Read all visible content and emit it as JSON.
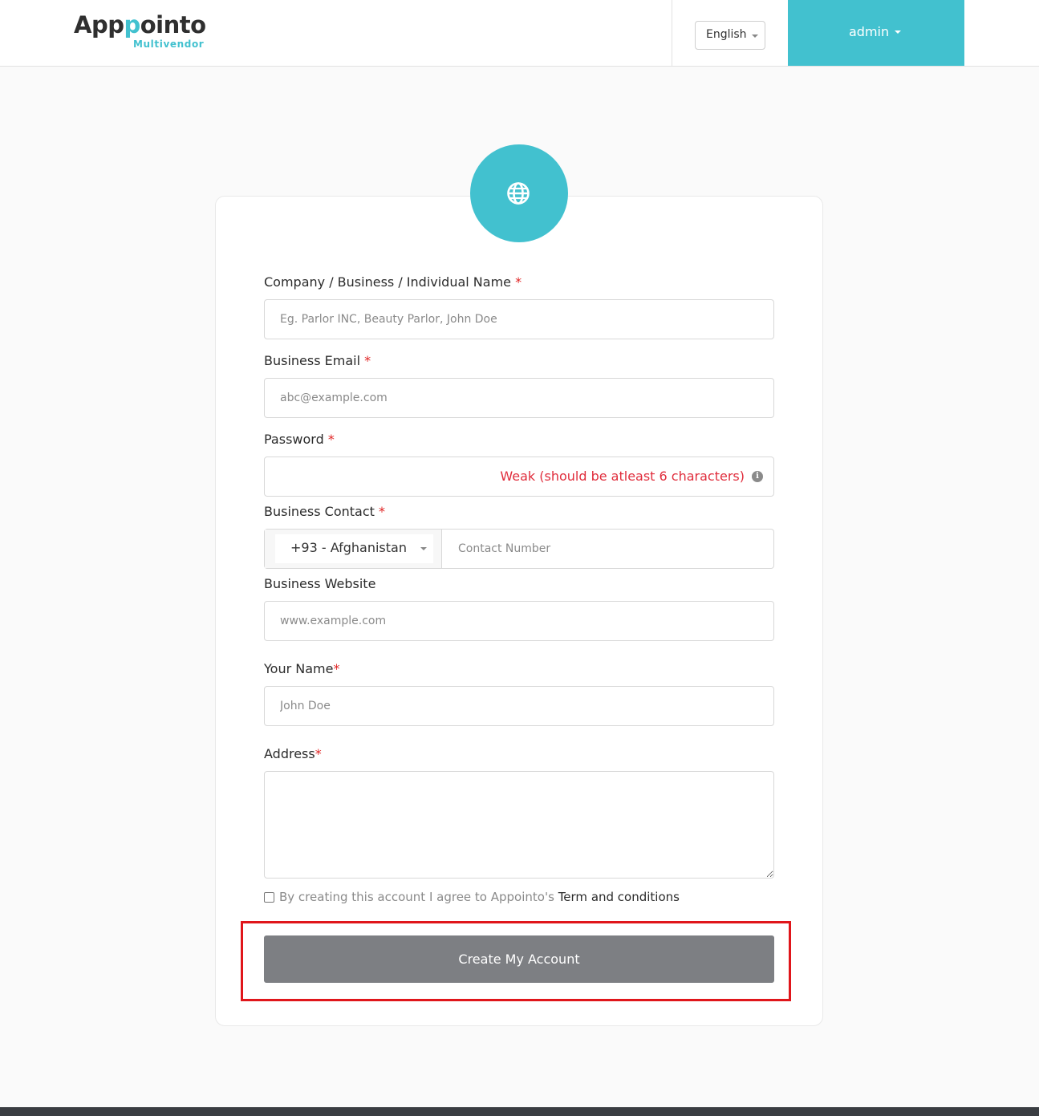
{
  "header": {
    "logo_prefix": "App",
    "logo_accent": "p",
    "logo_suffix": "ointo",
    "logo_sub": "Multivendor",
    "language": "English",
    "user": "admin"
  },
  "form": {
    "company_label": "Company / Business / Individual Name",
    "company_placeholder": "Eg. Parlor INC, Beauty Parlor, John Doe",
    "email_label": "Business Email",
    "email_placeholder": "abc@example.com",
    "password_label": "Password",
    "password_hint": "Weak (should be atleast 6 characters)",
    "contact_label": "Business Contact",
    "country_code": "+93 - Afghanistan",
    "contact_placeholder": "Contact Number",
    "website_label": "Business Website",
    "website_placeholder": "www.example.com",
    "your_name_label": "Your Name",
    "your_name_placeholder": "John Doe",
    "address_label": "Address",
    "required_mark": "*",
    "terms_text": "By creating this account I agree to Appointo's",
    "terms_link": "Term and conditions",
    "submit_label": "Create My Account"
  },
  "colors": {
    "accent": "#42c1cf",
    "error": "#e02d3c",
    "button": "#7d7f83",
    "highlight": "#e0161b"
  },
  "icons": {
    "card_icon": "globe-icon",
    "password_info": "info-icon"
  }
}
